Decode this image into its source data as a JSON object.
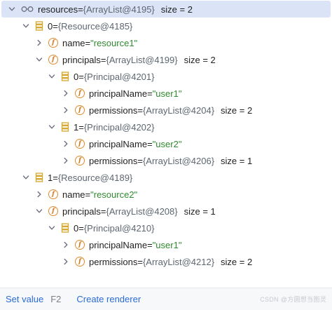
{
  "tree": {
    "rows": [
      {
        "expanded": true,
        "icon": "glasses-icon",
        "name": "resources",
        "eq": " = ",
        "value": "{ArrayList@4195}",
        "size": "size = 2"
      },
      {
        "expanded": true,
        "icon": "array-item-icon",
        "name": "0",
        "eq": " = ",
        "value": "{Resource@4185}",
        "size": ""
      },
      {
        "expanded": false,
        "icon": "field-icon",
        "name": "name",
        "eq": " = ",
        "value": "\"resource1\"",
        "size": ""
      },
      {
        "expanded": true,
        "icon": "field-icon",
        "name": "principals",
        "eq": " = ",
        "value": "{ArrayList@4199}",
        "size": "size = 2"
      },
      {
        "expanded": true,
        "icon": "array-item-icon",
        "name": "0",
        "eq": " = ",
        "value": "{Principal@4201}",
        "size": ""
      },
      {
        "expanded": false,
        "icon": "field-icon",
        "name": "principalName",
        "eq": " = ",
        "value": "\"user1\"",
        "size": ""
      },
      {
        "expanded": false,
        "icon": "field-icon",
        "name": "permissions",
        "eq": " = ",
        "value": "{ArrayList@4204}",
        "size": "size = 2"
      },
      {
        "expanded": true,
        "icon": "array-item-icon",
        "name": "1",
        "eq": " = ",
        "value": "{Principal@4202}",
        "size": ""
      },
      {
        "expanded": false,
        "icon": "field-icon",
        "name": "principalName",
        "eq": " = ",
        "value": "\"user2\"",
        "size": ""
      },
      {
        "expanded": false,
        "icon": "field-icon",
        "name": "permissions",
        "eq": " = ",
        "value": "{ArrayList@4206}",
        "size": "size = 1"
      },
      {
        "expanded": true,
        "icon": "array-item-icon",
        "name": "1",
        "eq": " = ",
        "value": "{Resource@4189}",
        "size": ""
      },
      {
        "expanded": false,
        "icon": "field-icon",
        "name": "name",
        "eq": " = ",
        "value": "\"resource2\"",
        "size": ""
      },
      {
        "expanded": true,
        "icon": "field-icon",
        "name": "principals",
        "eq": " = ",
        "value": "{ArrayList@4208}",
        "size": "size = 1"
      },
      {
        "expanded": true,
        "icon": "array-item-icon",
        "name": "0",
        "eq": " = ",
        "value": "{Principal@4210}",
        "size": ""
      },
      {
        "expanded": false,
        "icon": "field-icon",
        "name": "principalName",
        "eq": " = ",
        "value": "\"user1\"",
        "size": ""
      },
      {
        "expanded": false,
        "icon": "field-icon",
        "name": "permissions",
        "eq": " = ",
        "value": "{ArrayList@4212}",
        "size": "size = 2"
      }
    ]
  },
  "bottom_bar": {
    "set_value": "Set value",
    "set_value_shortcut": "F2",
    "create_renderer": "Create renderer"
  },
  "watermark": "CSDN @方圆想当图灵",
  "colors": {
    "selection": "#dbe4f7",
    "string_value": "#2f8a2f",
    "field_icon": "#e08a2e",
    "array_icon": "#d4a72c",
    "link": "#2a6cd6"
  }
}
